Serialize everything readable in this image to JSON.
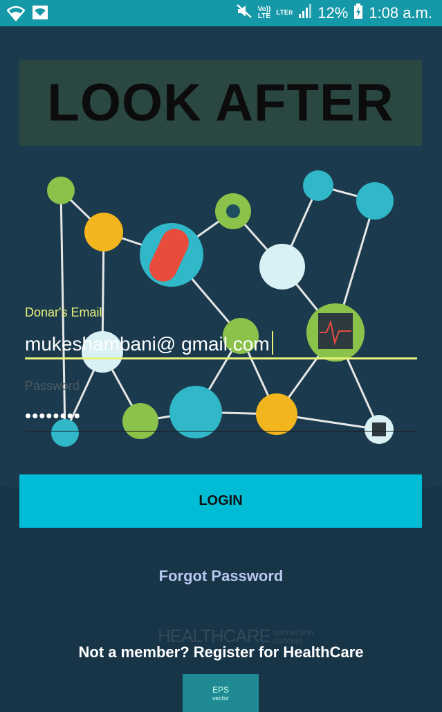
{
  "status_bar": {
    "volte_line1": "Vo))",
    "volte_line2": "LTE",
    "lte_line1": "LTE",
    "lte_r": "R",
    "battery": "12%",
    "time": "1:08 a.m.",
    "icons": [
      "wifi-icon",
      "image-notification-icon",
      "mute-icon",
      "signal-icon",
      "battery-charging-icon"
    ]
  },
  "header": {
    "title": "LOOK AFTER"
  },
  "form": {
    "email_label": "Donar's Email",
    "email_value": "mukeshambani@ gmail.com",
    "password_label": "Password",
    "password_value": "••••••••",
    "login_label": "LOGIN"
  },
  "links": {
    "forgot_password": "Forgot Password",
    "register": "Not a member? Register for HealthCare"
  },
  "background": {
    "logo_main": "HEALTHCARE",
    "logo_sub1": "connection",
    "logo_sub2": "concept",
    "eps_line1": "EPS",
    "eps_line2": "vector"
  },
  "colors": {
    "status_bar": "#1598a8",
    "accent": "#e8f27a",
    "button": "#00bcd4",
    "background": "#1b3a4d"
  }
}
